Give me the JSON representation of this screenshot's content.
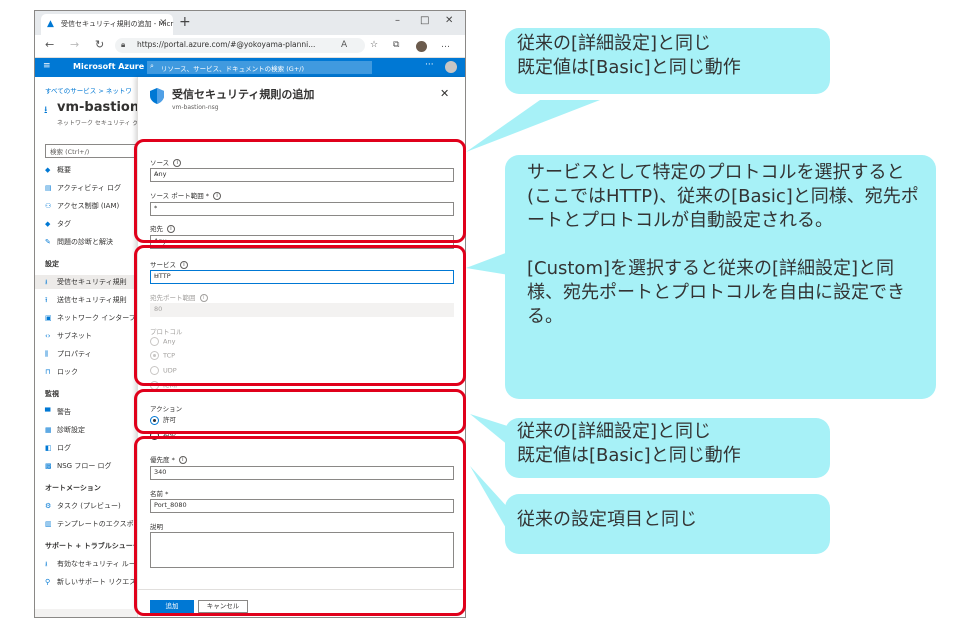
{
  "browser": {
    "tab_title": "受信セキュリティ規則の追加 - Micr",
    "url": "https://portal.azure.com/#@yokoyama-planni..."
  },
  "azure": {
    "brand": "Microsoft Azure",
    "search_placeholder": "リソース、サービス、ドキュメントの検索 (G+/)"
  },
  "sidebar": {
    "breadcrumb": "すべてのサービス > ネットワ",
    "resource_name": "vm-bastion",
    "resource_type": "ネットワーク セキュリティ グ",
    "search": "検索 (Ctrl+/)",
    "items": [
      {
        "label": "概要",
        "icon": "shield-icon"
      },
      {
        "label": "アクティビティ ログ",
        "icon": "log-icon"
      },
      {
        "label": "アクセス制御 (IAM)",
        "icon": "people-icon"
      },
      {
        "label": "タグ",
        "icon": "tag-icon"
      },
      {
        "label": "問題の診断と解決",
        "icon": "wrench-icon"
      }
    ],
    "section_settings": "設定",
    "settings_items": [
      {
        "label": "受信セキュリティ規則",
        "icon": "inbound-icon"
      },
      {
        "label": "送信セキュリティ規則",
        "icon": "outbound-icon"
      },
      {
        "label": "ネットワーク インターフェイ",
        "icon": "nic-icon"
      },
      {
        "label": "サブネット",
        "icon": "subnet-icon"
      },
      {
        "label": "プロパティ",
        "icon": "properties-icon"
      },
      {
        "label": "ロック",
        "icon": "lock-icon"
      }
    ],
    "section_monitoring": "監視",
    "monitoring_items": [
      {
        "label": "警告",
        "icon": "alert-icon"
      },
      {
        "label": "診断設定",
        "icon": "diagnostic-icon"
      },
      {
        "label": "ログ",
        "icon": "logs-icon"
      },
      {
        "label": "NSG フロー ログ",
        "icon": "flowlog-icon"
      }
    ],
    "section_automation": "オートメーション",
    "automation_items": [
      {
        "label": "タスク (プレビュー)",
        "icon": "task-icon"
      },
      {
        "label": "テンプレートのエクスポート",
        "icon": "export-icon"
      }
    ],
    "section_support": "サポート + トラブルシューティング",
    "support_items": [
      {
        "label": "有効なセキュリティ ルール",
        "icon": "rule-icon"
      },
      {
        "label": "新しいサポート リクエスト",
        "icon": "support-icon"
      }
    ]
  },
  "blade": {
    "title": "受信セキュリティ規則の追加",
    "subtitle": "vm-bastion-nsg",
    "source_label": "ソース",
    "source_value": "Any",
    "source_port_label": "ソース ポート範囲 *",
    "source_port_value": "*",
    "dest_label": "宛先",
    "dest_value": "Any",
    "service_label": "サービス",
    "service_value": "HTTP",
    "dest_port_label": "宛先ポート範囲",
    "dest_port_value": "80",
    "protocol_label": "プロトコル",
    "protocols": [
      "Any",
      "TCP",
      "UDP",
      "ICMP"
    ],
    "protocol_selected": "TCP",
    "action_label": "アクション",
    "actions": [
      "許可",
      "拒否"
    ],
    "action_selected": "許可",
    "priority_label": "優先度 *",
    "priority_value": "340",
    "name_label": "名前 *",
    "name_value": "Port_8080",
    "description_label": "説明",
    "add_button": "追加",
    "cancel_button": "キャンセル"
  },
  "callouts": {
    "c1": "従来の[詳細設定]と同じ\n既定値は[Basic]と同じ動作",
    "c2": "サービスとして特定のプロトコルを選択すると(ここではHTTP)、従来の[Basic]と同様、宛先ポートとプロトコルが自動設定される。\n\n[Custom]を選択すると従来の[詳細設定]と同様、宛先ポートとプロトコルを自由に設定できる。",
    "c3": "従来の[詳細設定]と同じ\n既定値は[Basic]と同じ動作",
    "c4": "従来の設定項目と同じ"
  },
  "colors": {
    "azure_blue": "#0078d4",
    "highlight_red": "#e0001b",
    "callout_cyan": "#a7f1f7"
  }
}
